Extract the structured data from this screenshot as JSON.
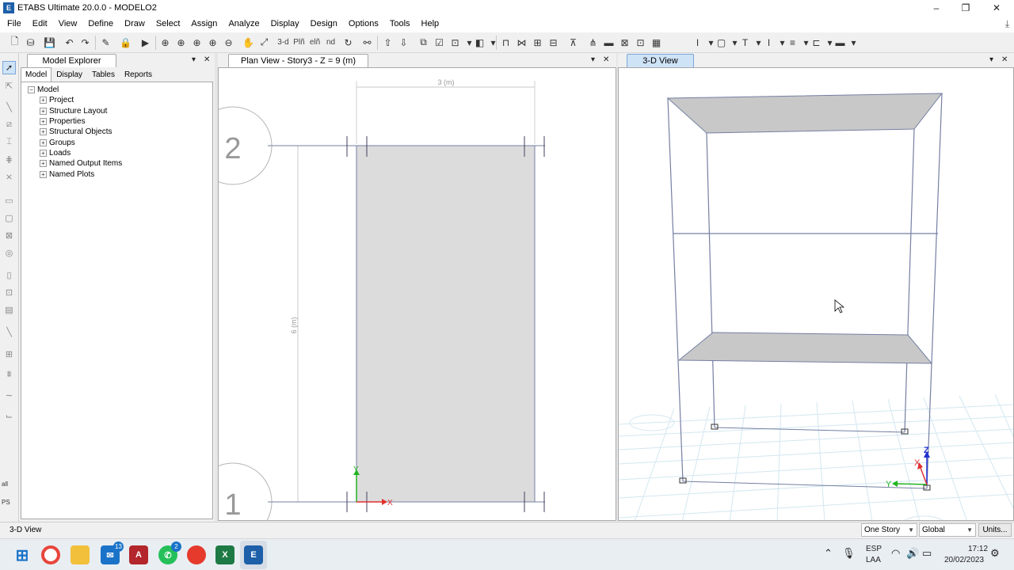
{
  "window": {
    "title": "ETABS Ultimate 20.0.0 - MODELO2",
    "logo": "E",
    "minimize_glyph": "–",
    "maximize_glyph": "❐",
    "close_glyph": "✕"
  },
  "menu": [
    "File",
    "Edit",
    "View",
    "Define",
    "Draw",
    "Select",
    "Assign",
    "Analyze",
    "Display",
    "Design",
    "Options",
    "Tools",
    "Help"
  ],
  "toolbar": {
    "view_3d_label": "3-d",
    "plan_label": "Plñ",
    "elev_label": "elñ",
    "nd_label": "nd"
  },
  "left_toolbar": {
    "all_label": "all",
    "ps_label": "PS"
  },
  "explorer": {
    "title": "Model Explorer",
    "tabs": [
      "Model",
      "Display",
      "Tables",
      "Reports"
    ],
    "root": "Model",
    "items": [
      "Project",
      "Structure Layout",
      "Properties",
      "Structural Objects",
      "Groups",
      "Loads",
      "Named Output Items",
      "Named Plots"
    ],
    "collapse_glyph": "−",
    "expand_glyph": "+"
  },
  "plan_view": {
    "title": "Plan View - Story3 - Z = 9 (m)",
    "dim_top": "3 (m)",
    "dim_left": "6 (m)",
    "grid_top": "2",
    "grid_bottom": "1",
    "axis_x": "X",
    "axis_y": "Y"
  },
  "view_3d": {
    "title": "3-D View",
    "axis_x": "X",
    "axis_y": "Y",
    "axis_z": "Z"
  },
  "panel_controls": {
    "pin": "▾",
    "close": "✕"
  },
  "colors": {
    "frame": "#7580a3",
    "slab": "#dcdcdc",
    "slab_3d": "#c8c8c8",
    "grid_3d": "#cfe4ef",
    "axis_x": "#e03030",
    "axis_y": "#22b422",
    "axis_z": "#2030d0",
    "active_tab": "#cfe3f7"
  },
  "status": {
    "text": "3-D View",
    "story_mode": "One Story",
    "coord_system": "Global",
    "units_button": "Units..."
  },
  "taskbar": {
    "mail_badge": "13",
    "whatsapp_badge": "2",
    "lang_line1": "ESP",
    "lang_line2": "LAA",
    "time": "17:12",
    "date": "20/02/2023"
  }
}
